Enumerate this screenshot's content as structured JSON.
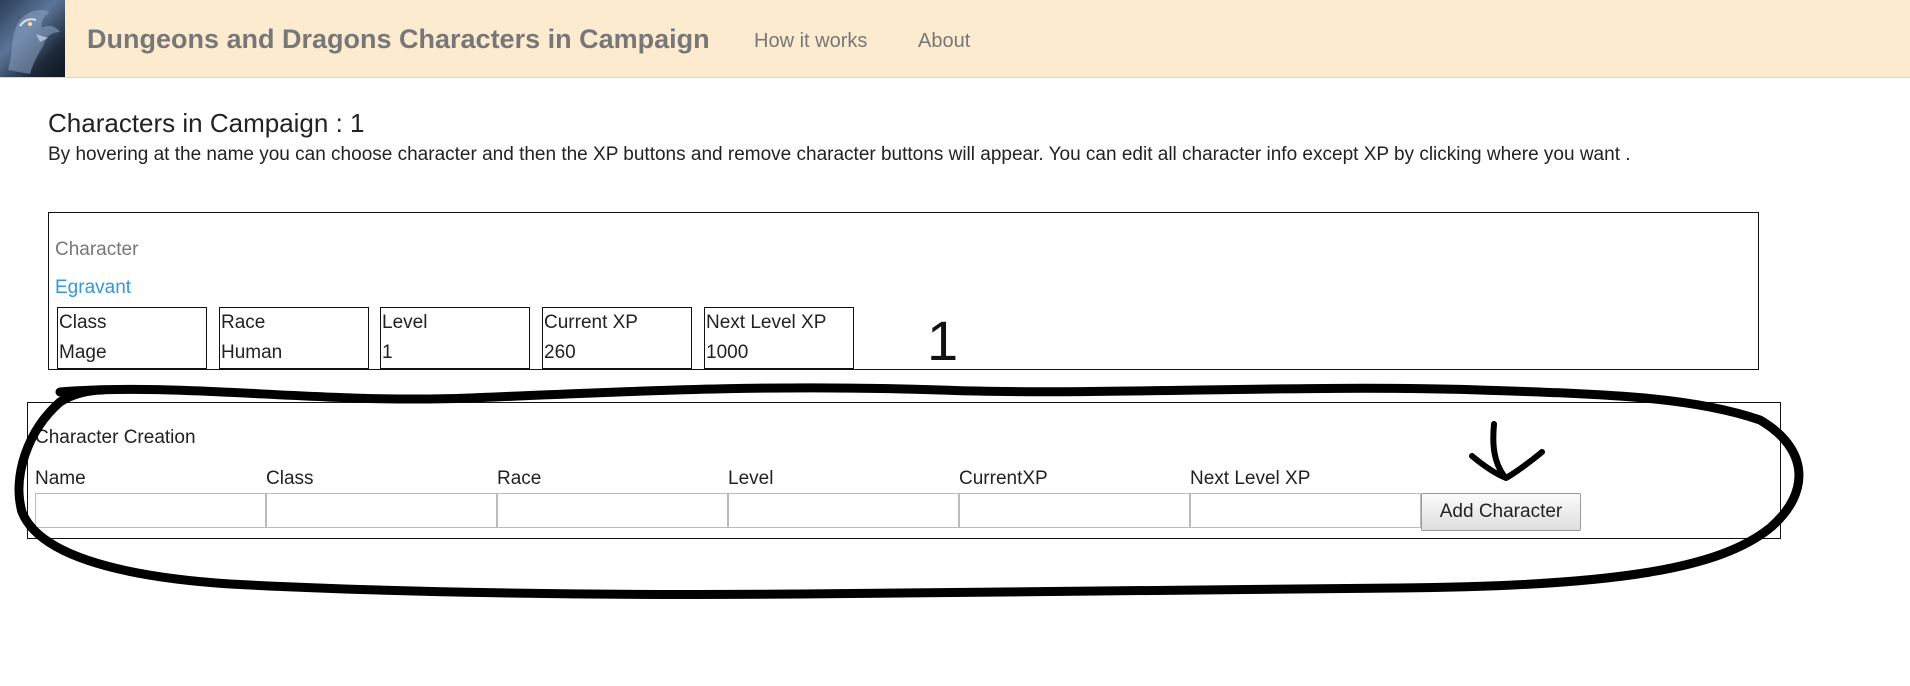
{
  "navbar": {
    "brand": "Dungeons and Dragons Characters in Campaign",
    "links": [
      "How it works",
      "About"
    ]
  },
  "main": {
    "title": "Characters in Campaign : 1",
    "instructions": "By hovering at the name you can choose character and then the XP buttons and remove character buttons will appear. You can edit all character info except XP by clicking where you want ."
  },
  "character_list": {
    "header": "Character",
    "characters": [
      {
        "name": "Egravant",
        "stats": [
          {
            "label": "Class",
            "value": "Mage"
          },
          {
            "label": "Race",
            "value": "Human"
          },
          {
            "label": "Level",
            "value": "1"
          },
          {
            "label": "Current XP",
            "value": "260"
          },
          {
            "label": "Next Level XP",
            "value": "1000"
          }
        ]
      }
    ]
  },
  "annotation": {
    "number": "1"
  },
  "creation": {
    "title": "Character Creation",
    "fields": [
      {
        "label": "Name",
        "value": "",
        "placeholder": ""
      },
      {
        "label": "Class",
        "value": "",
        "placeholder": ""
      },
      {
        "label": "Race",
        "value": "",
        "placeholder": ""
      },
      {
        "label": "Level",
        "value": "",
        "placeholder": ""
      },
      {
        "label": "CurrentXP",
        "value": "",
        "placeholder": ""
      },
      {
        "label": "Next Level XP",
        "value": "",
        "placeholder": ""
      }
    ],
    "add_button_label": "Add Character"
  },
  "colors": {
    "navbar_bg": "#fdebd0",
    "brand_text": "#777777",
    "character_link": "#3498db",
    "annotation_ink": "#000000"
  },
  "icons": {
    "logo": "dragon-logo-icon",
    "annotation_arrow": "arrow-down-icon"
  }
}
